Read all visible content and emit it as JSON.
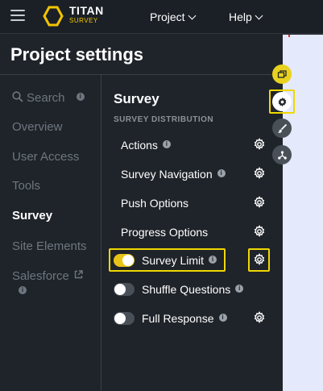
{
  "header": {
    "brand_name": "TITAN",
    "brand_sub": "SURVEY",
    "nav": [
      {
        "label": "Project"
      },
      {
        "label": "Help"
      }
    ]
  },
  "panel": {
    "title": "Project settings"
  },
  "left_nav": {
    "items": [
      {
        "label": "Search",
        "info": "i"
      },
      {
        "label": "Overview"
      },
      {
        "label": "User Access"
      },
      {
        "label": "Tools"
      },
      {
        "label": "Survey",
        "active": true
      },
      {
        "label": "Site Elements"
      },
      {
        "label": "Salesforce",
        "info": "i"
      }
    ]
  },
  "survey": {
    "title": "Survey",
    "subtitle": "SURVEY DISTRIBUTION",
    "rows": [
      {
        "label": "Actions",
        "info": "i",
        "gear": true
      },
      {
        "label": "Survey Navigation",
        "info": "i",
        "gear": true
      },
      {
        "label": "Push Options",
        "gear": true
      },
      {
        "label": "Progress Options",
        "gear": true
      },
      {
        "label": "Survey Limit",
        "info": "i",
        "toggle": "on",
        "gear": true
      },
      {
        "label": "Shuffle Questions",
        "info": "i",
        "toggle": "off"
      },
      {
        "label": "Full Response",
        "info": "i",
        "toggle": "off",
        "gear": true
      }
    ]
  },
  "colors": {
    "accent": "#f0d800",
    "toggle_on": "#e8c417",
    "background": "#1f242a",
    "canvas": "#e4e9fb"
  },
  "floating_icons": [
    "copy-icon",
    "gear-icon",
    "brush-icon",
    "network-icon"
  ]
}
